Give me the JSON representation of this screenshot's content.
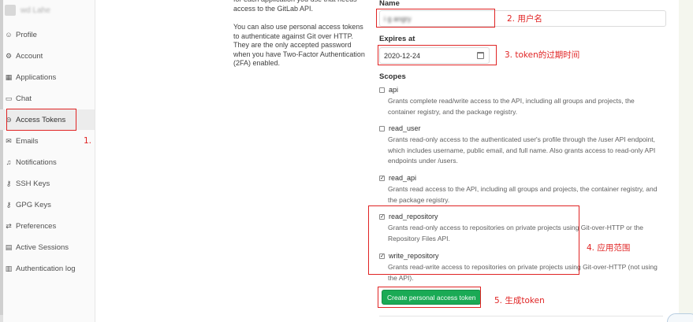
{
  "sidebar": {
    "username": "wd Lahe",
    "items": [
      {
        "label": "Profile",
        "icon": "profile-icon",
        "glyph": "☺"
      },
      {
        "label": "Account",
        "icon": "account-icon",
        "glyph": "⚙"
      },
      {
        "label": "Applications",
        "icon": "applications-icon",
        "glyph": "▦"
      },
      {
        "label": "Chat",
        "icon": "chat-icon",
        "glyph": "▭"
      },
      {
        "label": "Access Tokens",
        "icon": "access-token-icon",
        "glyph": "⊖"
      },
      {
        "label": "Emails",
        "icon": "email-icon",
        "glyph": "✉"
      },
      {
        "label": "Notifications",
        "icon": "notification-icon",
        "glyph": "♫"
      },
      {
        "label": "SSH Keys",
        "icon": "key-icon",
        "glyph": "⚷"
      },
      {
        "label": "GPG Keys",
        "icon": "key-icon",
        "glyph": "⚷"
      },
      {
        "label": "Preferences",
        "icon": "preferences-icon",
        "glyph": "⇄"
      },
      {
        "label": "Active Sessions",
        "icon": "sessions-icon",
        "glyph": "▤"
      },
      {
        "label": "Authentication log",
        "icon": "log-icon",
        "glyph": "▥"
      }
    ]
  },
  "help": {
    "line_top": "for each application you use that needs access to the GitLab API.",
    "paragraph": "You can also use personal access tokens to authenticate against Git over HTTP. They are the only accepted password when you have Two-Factor Authentication (2FA) enabled."
  },
  "form": {
    "name_label": "Name",
    "name_value": "i g angry",
    "expires_label": "Expires at",
    "expires_value": "2020-12-24",
    "scopes_label": "Scopes",
    "scopes": [
      {
        "name": "api",
        "checked": false,
        "description": "Grants complete read/write access to the API, including all groups and projects, the container registry, and the package registry."
      },
      {
        "name": "read_user",
        "checked": false,
        "description": "Grants read-only access to the authenticated user's profile through the /user API endpoint, which includes username, public email, and full name. Also grants access to read-only API endpoints under /users."
      },
      {
        "name": "read_api",
        "checked": true,
        "description": "Grants read access to the API, including all groups and projects, the container registry, and the package registry."
      },
      {
        "name": "read_repository",
        "checked": true,
        "description": "Grants read-only access to repositories on private projects using Git-over-HTTP or the Repository Files API."
      },
      {
        "name": "write_repository",
        "checked": true,
        "description": "Grants read-write access to repositories on private projects using Git-over-HTTP (not using the API)."
      }
    ],
    "submit_label": "Create personal access token"
  },
  "annotations": {
    "a1": "1.",
    "a2": "2. 用户名",
    "a3": "3. token的过期时间",
    "a4": "4. 应用范围",
    "a5": "5. 生成token",
    "color": "#e02424"
  },
  "colors": {
    "primary_button": "#1aaa55",
    "sidebar_bg": "#fafafa"
  }
}
